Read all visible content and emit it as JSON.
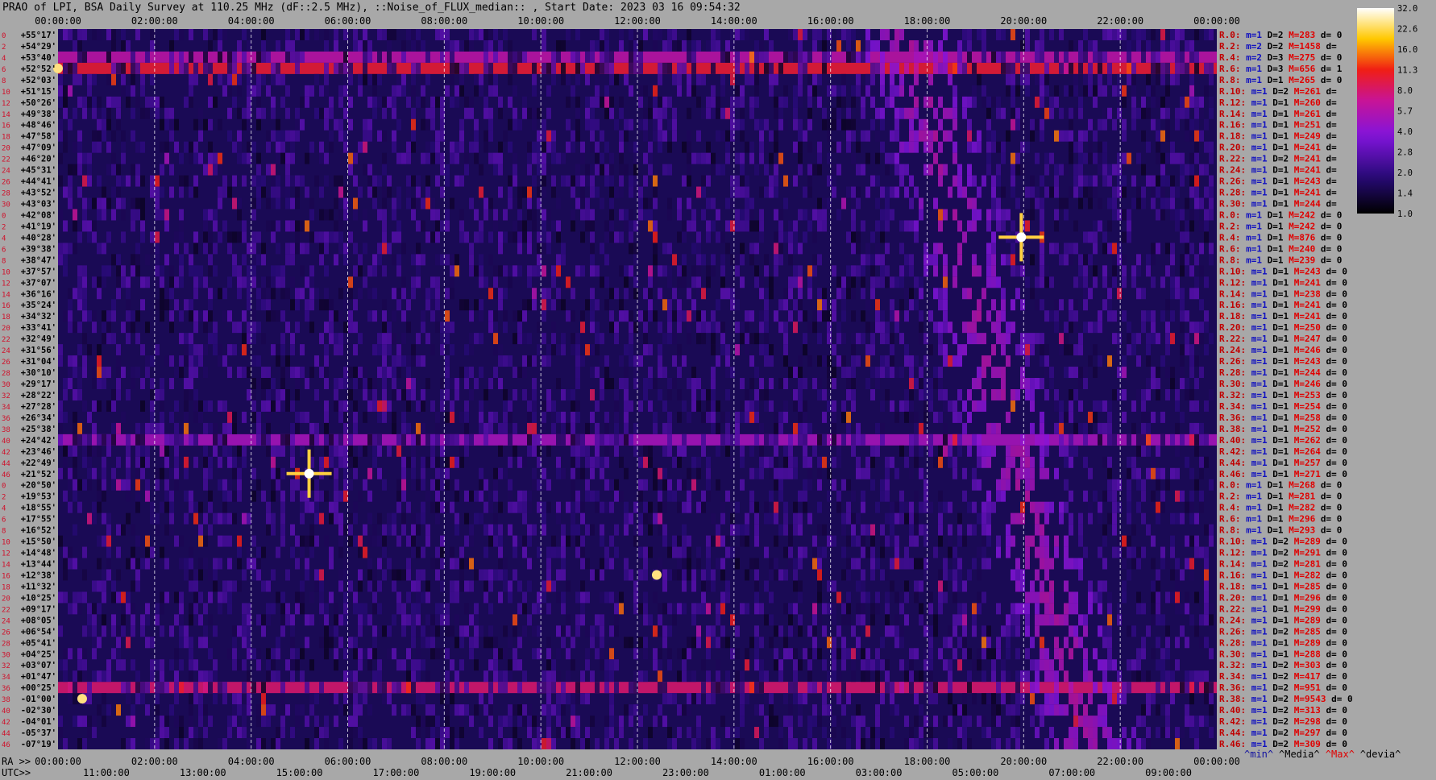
{
  "title": "PRAO of LPI, BSA Daily Survey at 110.25 MHz (dF::2.5 MHz), ::Noise_of_FLUX_median:: , Start Date: 2023 03 16 09:54:32",
  "colors": {
    "background": "#a8a8a8",
    "plot_bg": "#1a0a55",
    "ra_label": "#c00000",
    "m_value": "#1010c0",
    "d_value": "#000000",
    "max_value": "#e00000",
    "legend_min": "#1010a0",
    "legend_media": "#000000",
    "legend_max": "#e00000",
    "legend_devia": "#000000"
  },
  "chart_data": {
    "type": "heatmap",
    "title": "PRAO of LPI, BSA Daily Survey at 110.25 MHz (dF::2.5 MHz), ::Noise_of_FLUX_median:: , Start Date: 2023 03 16 09:54:32",
    "colormap": "black-purple-red-yellow-white",
    "x_top_labels": [
      "00:00:00",
      "02:00:00",
      "04:00:00",
      "06:00:00",
      "08:00:00",
      "10:00:00",
      "12:00:00",
      "14:00:00",
      "16:00:00",
      "18:00:00",
      "20:00:00",
      "22:00:00",
      "00:00:00"
    ],
    "x_bottom_ra_prefix": "RA >>",
    "x_bottom_ra_labels": [
      "00:00:00",
      "02:00:00",
      "04:00:00",
      "06:00:00",
      "08:00:00",
      "10:00:00",
      "12:00:00",
      "14:00:00",
      "16:00:00",
      "18:00:00",
      "20:00:00",
      "22:00:00",
      "00:00:00"
    ],
    "x_bottom_utc_prefix": "UTC>>",
    "x_bottom_utc_labels": [
      "11:00:00",
      "13:00:00",
      "15:00:00",
      "17:00:00",
      "19:00:00",
      "21:00:00",
      "23:00:00",
      "01:00:00",
      "03:00:00",
      "05:00:00",
      "07:00:00",
      "09:00:00"
    ],
    "y_labels": [
      "+55°17'",
      "+54°29'",
      "+53°40'",
      "+52°52'",
      "+52°03'",
      "+51°15'",
      "+50°26'",
      "+49°38'",
      "+48°46'",
      "+47°58'",
      "+47°09'",
      "+46°20'",
      "+45°31'",
      "+44°41'",
      "+43°52'",
      "+43°03'",
      "+42°08'",
      "+41°19'",
      "+40°28'",
      "+39°38'",
      "+38°47'",
      "+37°57'",
      "+37°07'",
      "+36°16'",
      "+35°24'",
      "+34°32'",
      "+33°41'",
      "+32°49'",
      "+31°56'",
      "+31°04'",
      "+30°10'",
      "+29°17'",
      "+28°22'",
      "+27°28'",
      "+26°34'",
      "+25°38'",
      "+24°42'",
      "+23°46'",
      "+22°49'",
      "+21°52'",
      "+20°50'",
      "+19°53'",
      "+18°55'",
      "+17°55'",
      "+16°52'",
      "+15°50'",
      "+14°48'",
      "+13°44'",
      "+12°38'",
      "+11°32'",
      "+10°25'",
      "+09°17'",
      "+08°05'",
      "+06°54'",
      "+05°41'",
      "+04°25'",
      "+03°07'",
      "+01°47'",
      "+00°25'",
      "-01°00'",
      "-02°30'",
      "-04°01'",
      "-05°37'",
      "-07°19'"
    ],
    "row_index": [
      "0",
      "2",
      "4",
      "6",
      "8",
      "10",
      "12",
      "14",
      "16",
      "18",
      "20",
      "22",
      "24",
      "26",
      "28",
      "30",
      "0",
      "2",
      "4",
      "6",
      "8",
      "10",
      "12",
      "14",
      "16",
      "18",
      "20",
      "22",
      "24",
      "26",
      "28",
      "30",
      "32",
      "34",
      "36",
      "38",
      "40",
      "42",
      "44",
      "46",
      "0",
      "2",
      "4",
      "6",
      "8",
      "10",
      "12",
      "14",
      "16",
      "18",
      "20",
      "22",
      "24",
      "26",
      "28",
      "30",
      "32",
      "34",
      "36",
      "38",
      "40",
      "42",
      "44",
      "46"
    ],
    "color_scale": {
      "labels": [
        "32.0",
        "22.6",
        "16.0",
        "11.3",
        "8.0",
        "5.7",
        "4.0",
        "2.8",
        "2.0",
        "1.4",
        "1.0"
      ],
      "max": 32.0,
      "min": 1.0,
      "log": true
    },
    "calibration_rows": [
      {
        "ra": "R.0:",
        "m": "m=1",
        "d": "D=2",
        "max": "M=283",
        "dev": "d= 0"
      },
      {
        "ra": "R.2:",
        "m": "m=2",
        "d": "D=2",
        "max": "M=1458",
        "dev": "d="
      },
      {
        "ra": "R.4:",
        "m": "m=2",
        "d": "D=3",
        "max": "M=275",
        "dev": "d= 0"
      },
      {
        "ra": "R.6:",
        "m": "m=1",
        "d": "D=3",
        "max": "M=656",
        "dev": "d= 1"
      },
      {
        "ra": "R.8:",
        "m": "m=1",
        "d": "D=1",
        "max": "M=265",
        "dev": "d= 0"
      },
      {
        "ra": "R.10:",
        "m": "m=1",
        "d": "D=2",
        "max": "M=261",
        "dev": "d="
      },
      {
        "ra": "R.12:",
        "m": "m=1",
        "d": "D=1",
        "max": "M=260",
        "dev": "d="
      },
      {
        "ra": "R.14:",
        "m": "m=1",
        "d": "D=1",
        "max": "M=261",
        "dev": "d="
      },
      {
        "ra": "R.16:",
        "m": "m=1",
        "d": "D=1",
        "max": "M=251",
        "dev": "d="
      },
      {
        "ra": "R.18:",
        "m": "m=1",
        "d": "D=1",
        "max": "M=249",
        "dev": "d="
      },
      {
        "ra": "R.20:",
        "m": "m=1",
        "d": "D=1",
        "max": "M=241",
        "dev": "d="
      },
      {
        "ra": "R.22:",
        "m": "m=1",
        "d": "D=2",
        "max": "M=241",
        "dev": "d="
      },
      {
        "ra": "R.24:",
        "m": "m=1",
        "d": "D=1",
        "max": "M=241",
        "dev": "d="
      },
      {
        "ra": "R.26:",
        "m": "m=1",
        "d": "D=1",
        "max": "M=243",
        "dev": "d="
      },
      {
        "ra": "R.28:",
        "m": "m=1",
        "d": "D=1",
        "max": "M=241",
        "dev": "d="
      },
      {
        "ra": "R.30:",
        "m": "m=1",
        "d": "D=1",
        "max": "M=244",
        "dev": "d="
      },
      {
        "ra": "R.0:",
        "m": "m=1",
        "d": "D=1",
        "max": "M=242",
        "dev": "d= 0"
      },
      {
        "ra": "R.2:",
        "m": "m=1",
        "d": "D=1",
        "max": "M=242",
        "dev": "d= 0"
      },
      {
        "ra": "R.4:",
        "m": "m=1",
        "d": "D=1",
        "max": "M=876",
        "dev": "d= 0"
      },
      {
        "ra": "R.6:",
        "m": "m=1",
        "d": "D=1",
        "max": "M=240",
        "dev": "d= 0"
      },
      {
        "ra": "R.8:",
        "m": "m=1",
        "d": "D=1",
        "max": "M=239",
        "dev": "d= 0"
      },
      {
        "ra": "R.10:",
        "m": "m=1",
        "d": "D=1",
        "max": "M=243",
        "dev": "d= 0"
      },
      {
        "ra": "R.12:",
        "m": "m=1",
        "d": "D=1",
        "max": "M=241",
        "dev": "d= 0"
      },
      {
        "ra": "R.14:",
        "m": "m=1",
        "d": "D=1",
        "max": "M=238",
        "dev": "d= 0"
      },
      {
        "ra": "R.16:",
        "m": "m=1",
        "d": "D=1",
        "max": "M=241",
        "dev": "d= 0"
      },
      {
        "ra": "R.18:",
        "m": "m=1",
        "d": "D=1",
        "max": "M=241",
        "dev": "d= 0"
      },
      {
        "ra": "R.20:",
        "m": "m=1",
        "d": "D=1",
        "max": "M=250",
        "dev": "d= 0"
      },
      {
        "ra": "R.22:",
        "m": "m=1",
        "d": "D=1",
        "max": "M=247",
        "dev": "d= 0"
      },
      {
        "ra": "R.24:",
        "m": "m=1",
        "d": "D=1",
        "max": "M=246",
        "dev": "d= 0"
      },
      {
        "ra": "R.26:",
        "m": "m=1",
        "d": "D=1",
        "max": "M=243",
        "dev": "d= 0"
      },
      {
        "ra": "R.28:",
        "m": "m=1",
        "d": "D=1",
        "max": "M=244",
        "dev": "d= 0"
      },
      {
        "ra": "R.30:",
        "m": "m=1",
        "d": "D=1",
        "max": "M=246",
        "dev": "d= 0"
      },
      {
        "ra": "R.32:",
        "m": "m=1",
        "d": "D=1",
        "max": "M=253",
        "dev": "d= 0"
      },
      {
        "ra": "R.34:",
        "m": "m=1",
        "d": "D=1",
        "max": "M=254",
        "dev": "d= 0"
      },
      {
        "ra": "R.36:",
        "m": "m=1",
        "d": "D=1",
        "max": "M=258",
        "dev": "d= 0"
      },
      {
        "ra": "R.38:",
        "m": "m=1",
        "d": "D=1",
        "max": "M=252",
        "dev": "d= 0"
      },
      {
        "ra": "R.40:",
        "m": "m=1",
        "d": "D=1",
        "max": "M=262",
        "dev": "d= 0"
      },
      {
        "ra": "R.42:",
        "m": "m=1",
        "d": "D=1",
        "max": "M=264",
        "dev": "d= 0"
      },
      {
        "ra": "R.44:",
        "m": "m=1",
        "d": "D=1",
        "max": "M=257",
        "dev": "d= 0"
      },
      {
        "ra": "R.46:",
        "m": "m=1",
        "d": "D=1",
        "max": "M=271",
        "dev": "d= 0"
      },
      {
        "ra": "R.0:",
        "m": "m=1",
        "d": "D=1",
        "max": "M=268",
        "dev": "d= 0"
      },
      {
        "ra": "R.2:",
        "m": "m=1",
        "d": "D=1",
        "max": "M=281",
        "dev": "d= 0"
      },
      {
        "ra": "R.4:",
        "m": "m=1",
        "d": "D=1",
        "max": "M=282",
        "dev": "d= 0"
      },
      {
        "ra": "R.6:",
        "m": "m=1",
        "d": "D=1",
        "max": "M=296",
        "dev": "d= 0"
      },
      {
        "ra": "R.8:",
        "m": "m=1",
        "d": "D=1",
        "max": "M=293",
        "dev": "d= 0"
      },
      {
        "ra": "R.10:",
        "m": "m=1",
        "d": "D=2",
        "max": "M=289",
        "dev": "d= 0"
      },
      {
        "ra": "R.12:",
        "m": "m=1",
        "d": "D=2",
        "max": "M=291",
        "dev": "d= 0"
      },
      {
        "ra": "R.14:",
        "m": "m=1",
        "d": "D=2",
        "max": "M=281",
        "dev": "d= 0"
      },
      {
        "ra": "R.16:",
        "m": "m=1",
        "d": "D=1",
        "max": "M=282",
        "dev": "d= 0"
      },
      {
        "ra": "R.18:",
        "m": "m=1",
        "d": "D=1",
        "max": "M=285",
        "dev": "d= 0"
      },
      {
        "ra": "R.20:",
        "m": "m=1",
        "d": "D=1",
        "max": "M=296",
        "dev": "d= 0"
      },
      {
        "ra": "R.22:",
        "m": "m=1",
        "d": "D=1",
        "max": "M=299",
        "dev": "d= 0"
      },
      {
        "ra": "R.24:",
        "m": "m=1",
        "d": "D=1",
        "max": "M=289",
        "dev": "d= 0"
      },
      {
        "ra": "R.26:",
        "m": "m=1",
        "d": "D=2",
        "max": "M=285",
        "dev": "d= 0"
      },
      {
        "ra": "R.28:",
        "m": "m=1",
        "d": "D=1",
        "max": "M=289",
        "dev": "d= 0"
      },
      {
        "ra": "R.30:",
        "m": "m=1",
        "d": "D=1",
        "max": "M=288",
        "dev": "d= 0"
      },
      {
        "ra": "R.32:",
        "m": "m=1",
        "d": "D=2",
        "max": "M=303",
        "dev": "d= 0"
      },
      {
        "ra": "R.34:",
        "m": "m=1",
        "d": "D=2",
        "max": "M=417",
        "dev": "d= 0"
      },
      {
        "ra": "R.36:",
        "m": "m=1",
        "d": "D=2",
        "max": "M=951",
        "dev": "d= 0"
      },
      {
        "ra": "R.38:",
        "m": "m=1",
        "d": "D=2",
        "max": "M=9543",
        "dev": "d= 0"
      },
      {
        "ra": "R.40:",
        "m": "m=1",
        "d": "D=2",
        "max": "M=313",
        "dev": "d= 0"
      },
      {
        "ra": "R.42:",
        "m": "m=1",
        "d": "D=2",
        "max": "M=298",
        "dev": "d= 0"
      },
      {
        "ra": "R.44:",
        "m": "m=1",
        "d": "D=2",
        "max": "M=297",
        "dev": "d= 0"
      },
      {
        "ra": "R.46:",
        "m": "m=1",
        "d": "D=2",
        "max": "M=309",
        "dev": "d= 0"
      }
    ],
    "legend": [
      {
        "text": "^min^",
        "color": "#1010a0"
      },
      {
        "text": "^Media^",
        "color": "#000000"
      },
      {
        "text": "^Max^",
        "color": "#e00000"
      },
      {
        "text": "^devia^",
        "color": "#000000"
      }
    ],
    "bright_sources": [
      {
        "ra_hour": 19.95,
        "row": 18,
        "kind": "cross"
      },
      {
        "ra_hour": 0.0,
        "row": 3,
        "kind": "spot"
      },
      {
        "ra_hour": 5.2,
        "row": 39,
        "kind": "cross"
      },
      {
        "ra_hour": 12.4,
        "row": 48,
        "kind": "spot"
      },
      {
        "ra_hour": 24.5,
        "row": 59,
        "kind": "spot"
      }
    ],
    "horizontal_bands": [
      {
        "row": 2,
        "intensity": 6.0
      },
      {
        "row": 3,
        "intensity": 10.0
      },
      {
        "row": 36,
        "intensity": 5.0
      },
      {
        "row": 58,
        "intensity": 8.0
      }
    ]
  }
}
